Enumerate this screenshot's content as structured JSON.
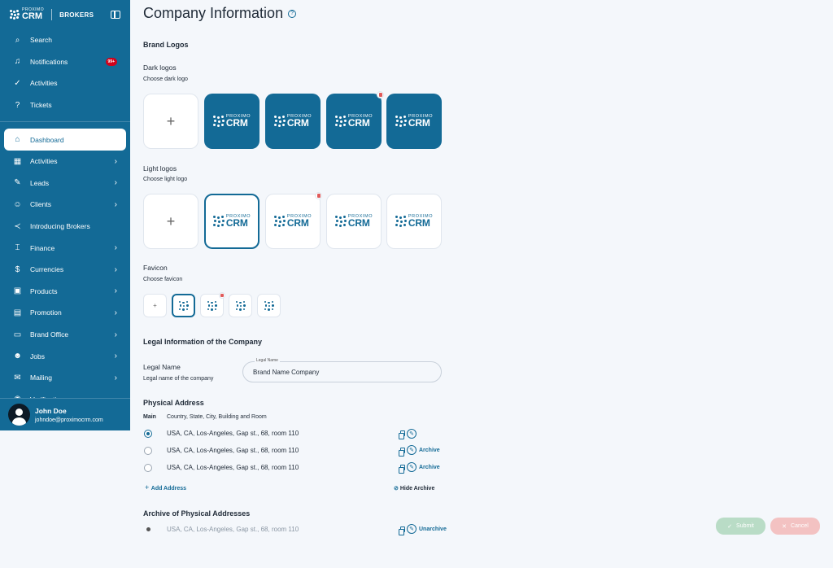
{
  "sidebar": {
    "logo_small": "PROXIMO",
    "logo_big": "CRM",
    "brand": "BROKERS",
    "top_items": [
      {
        "label": "Search",
        "icon": "search-icon"
      },
      {
        "label": "Notifications",
        "icon": "bell-icon",
        "badge": "99+"
      },
      {
        "label": "Activities",
        "icon": "check-circle-icon"
      },
      {
        "label": "Tickets",
        "icon": "question-square-icon"
      }
    ],
    "nav_items": [
      {
        "label": "Dashboard",
        "icon": "home-icon",
        "active": true
      },
      {
        "label": "Activities",
        "icon": "calendar-icon"
      },
      {
        "label": "Leads",
        "icon": "pencil-icon"
      },
      {
        "label": "Clients",
        "icon": "users-icon"
      },
      {
        "label": "Introducing Brokers",
        "icon": "share-icon"
      },
      {
        "label": "Finance",
        "icon": "bank-icon"
      },
      {
        "label": "Currencies",
        "icon": "dollar-icon"
      },
      {
        "label": "Products",
        "icon": "products-icon"
      },
      {
        "label": "Promotion",
        "icon": "promotion-icon"
      },
      {
        "label": "Brand Office",
        "icon": "briefcase-icon"
      },
      {
        "label": "Jobs",
        "icon": "jobs-icon"
      },
      {
        "label": "Mailing",
        "icon": "mail-icon"
      },
      {
        "label": "Verification",
        "icon": "verification-icon"
      }
    ],
    "user": {
      "name": "John Doe",
      "email": "johndoe@proximocrm.com"
    }
  },
  "page": {
    "title": "Company Information",
    "brand_logos": "Brand Logos",
    "dark_logos": "Dark logos",
    "dark_sub": "Choose dark logo",
    "light_logos": "Light logos",
    "light_sub": "Choose light logo",
    "favicon": "Favicon",
    "favicon_sub": "Choose favicon",
    "add_symbol": "+",
    "legal_title": "Legal Information of  the Company",
    "legal_name": "Legal Name",
    "legal_name_sub": "Legal name of the company",
    "legal_input_label": "Legal Name",
    "legal_input_value": "Brand Name Company",
    "physical_title": "Physical Address",
    "col_main": "Main",
    "col_address": "Country, State, City, Building and Room",
    "addresses": [
      {
        "text": "USA, CA, Los-Angeles, Gap st., 68, room 110",
        "main": true,
        "action": ""
      },
      {
        "text": "USA, CA, Los-Angeles, Gap st., 68, room 110",
        "main": false,
        "action": "Archive"
      },
      {
        "text": "USA, CA, Los-Angeles, Gap st., 68, room 110",
        "main": false,
        "action": "Archive"
      }
    ],
    "add_address": "Add Address",
    "hide_archive": "Hide Archive",
    "archive_title": "Archive of Physical Addresses",
    "archived": {
      "text": "USA, CA, Los-Angeles, Gap st., 68, room 110",
      "action": "Unarchive"
    },
    "submit": "Submit",
    "cancel": "Cancel"
  },
  "logo_text": {
    "small": "PROXIMO",
    "big": "CRM"
  },
  "colors": {
    "primary": "#136a96",
    "background": "#f4f7fb",
    "danger": "#e05a5a"
  }
}
